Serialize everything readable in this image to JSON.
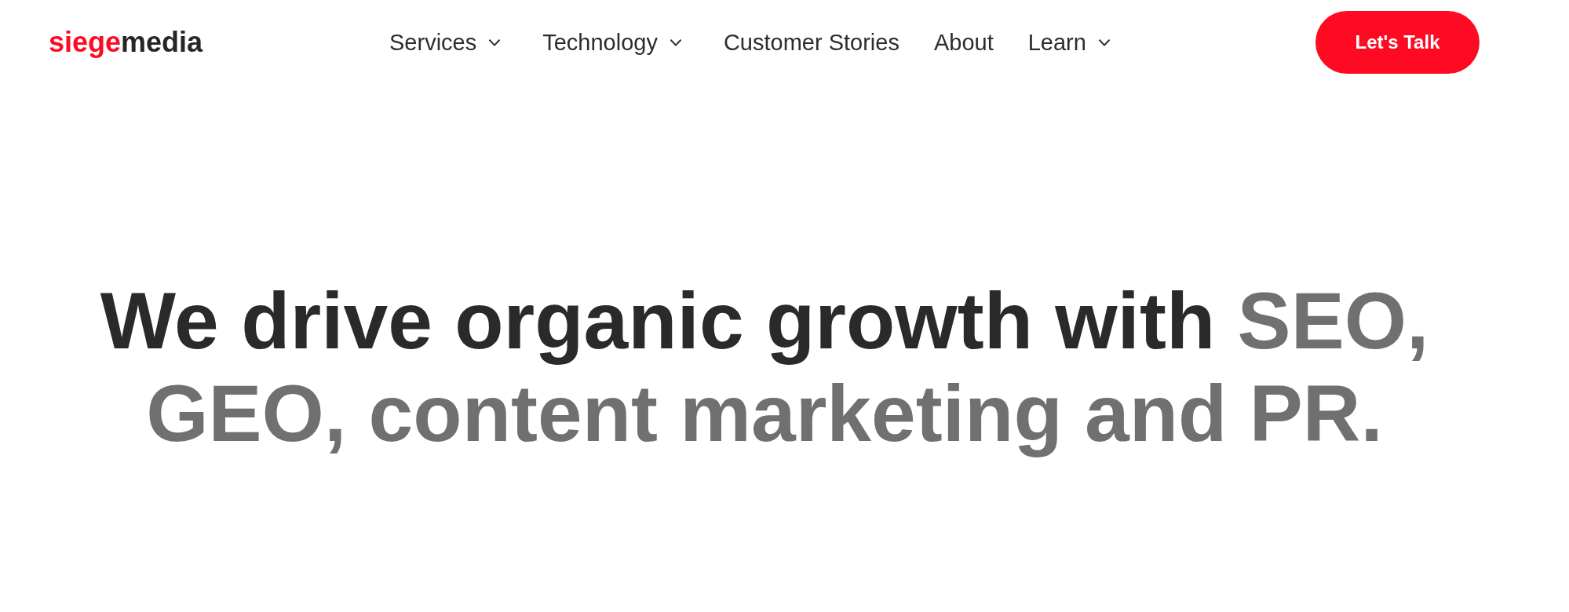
{
  "logo": {
    "lead": "siege",
    "tail": "media"
  },
  "nav": [
    {
      "label": "Services",
      "kind": "dropdown"
    },
    {
      "label": "Technology",
      "kind": "dropdown"
    },
    {
      "label": "Customer Stories",
      "kind": "link"
    },
    {
      "label": "About",
      "kind": "link"
    },
    {
      "label": "Learn",
      "kind": "dropdown"
    }
  ],
  "cta": {
    "label": "Let's Talk"
  },
  "headline": {
    "lead": "We drive organic growth with",
    "highlight": "SEO, GEO, content marketing and PR."
  }
}
